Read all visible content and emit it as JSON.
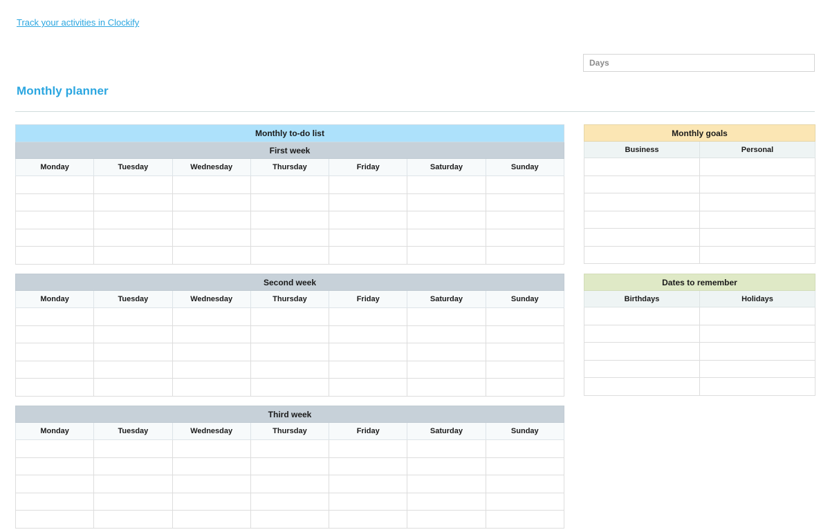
{
  "top_link": {
    "label": "Track your activities in Clockify",
    "color": "#2ba6e0"
  },
  "days_field": {
    "value": "",
    "placeholder": "Days"
  },
  "page_title": "Monthly planner",
  "colors": {
    "accent_blue": "#2ba6e0",
    "banner_blue": "#ade1fb",
    "week_band_gray": "#c7d1d9",
    "day_head": "#f7fafb",
    "goals_banner_yellow": "#fbe6b4",
    "dates_banner_green": "#dfe9c6",
    "panel_subhead": "#eef4f4",
    "grid_line": "#dddddd",
    "rule": "#cfdcdc"
  },
  "todo": {
    "banner": "Monthly to-do list",
    "day_headers": [
      "Monday",
      "Tuesday",
      "Wednesday",
      "Thursday",
      "Friday",
      "Saturday",
      "Sunday"
    ],
    "weeks": [
      {
        "label": "First week",
        "show_banner": true,
        "rows": 5,
        "cells": [
          [
            "",
            "",
            "",
            "",
            "",
            "",
            ""
          ],
          [
            "",
            "",
            "",
            "",
            "",
            "",
            ""
          ],
          [
            "",
            "",
            "",
            "",
            "",
            "",
            ""
          ],
          [
            "",
            "",
            "",
            "",
            "",
            "",
            ""
          ],
          [
            "",
            "",
            "",
            "",
            "",
            "",
            ""
          ]
        ]
      },
      {
        "label": "Second week",
        "show_banner": false,
        "rows": 5,
        "cells": [
          [
            "",
            "",
            "",
            "",
            "",
            "",
            ""
          ],
          [
            "",
            "",
            "",
            "",
            "",
            "",
            ""
          ],
          [
            "",
            "",
            "",
            "",
            "",
            "",
            ""
          ],
          [
            "",
            "",
            "",
            "",
            "",
            "",
            ""
          ],
          [
            "",
            "",
            "",
            "",
            "",
            "",
            ""
          ]
        ]
      },
      {
        "label": "Third week",
        "show_banner": false,
        "rows": 5,
        "cells": [
          [
            "",
            "",
            "",
            "",
            "",
            "",
            ""
          ],
          [
            "",
            "",
            "",
            "",
            "",
            "",
            ""
          ],
          [
            "",
            "",
            "",
            "",
            "",
            "",
            ""
          ],
          [
            "",
            "",
            "",
            "",
            "",
            "",
            ""
          ],
          [
            "",
            "",
            "",
            "",
            "",
            "",
            ""
          ]
        ]
      }
    ]
  },
  "monthly_goals": {
    "banner": "Monthly goals",
    "columns": [
      "Business",
      "Personal"
    ],
    "rows": [
      [
        "",
        ""
      ],
      [
        "",
        ""
      ],
      [
        "",
        ""
      ],
      [
        "",
        ""
      ],
      [
        "",
        ""
      ],
      [
        "",
        ""
      ]
    ]
  },
  "dates_to_remember": {
    "banner": "Dates to remember",
    "columns": [
      "Birthdays",
      "Holidays"
    ],
    "rows": [
      [
        "",
        ""
      ],
      [
        "",
        ""
      ],
      [
        "",
        ""
      ],
      [
        "",
        ""
      ],
      [
        "",
        ""
      ]
    ]
  }
}
